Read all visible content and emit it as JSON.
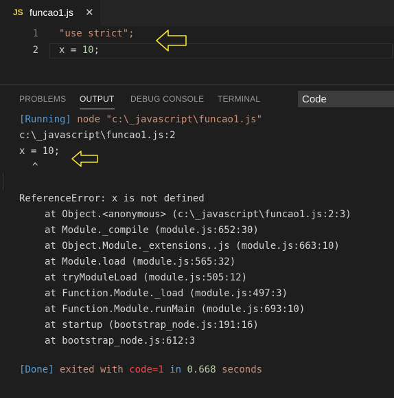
{
  "tab": {
    "lang_badge": "JS",
    "filename": "funcao1.js",
    "close": "✕"
  },
  "editor": {
    "lines": [
      {
        "number": "1",
        "text": "\"use strict\";"
      },
      {
        "number": "2",
        "prefix": "x = ",
        "value": "10",
        "suffix": ";"
      }
    ]
  },
  "panel": {
    "tabs": [
      "PROBLEMS",
      "OUTPUT",
      "DEBUG CONSOLE",
      "TERMINAL"
    ],
    "active_tab": "OUTPUT",
    "channel": "Code"
  },
  "output": {
    "running_tag": "[Running]",
    "running_cmd": "node \"c:\\_javascript\\funcao1.js\"",
    "file_line": "c:\\_javascript\\funcao1.js:2",
    "code_line": "x = 10;",
    "caret": "^",
    "error": "ReferenceError: x is not defined",
    "stack": [
      "at Object.<anonymous> (c:\\_javascript\\funcao1.js:2:3)",
      "at Module._compile (module.js:652:30)",
      "at Object.Module._extensions..js (module.js:663:10)",
      "at Module.load (module.js:565:32)",
      "at tryModuleLoad (module.js:505:12)",
      "at Function.Module._load (module.js:497:3)",
      "at Function.Module.runMain (module.js:693:10)",
      "at startup (bootstrap_node.js:191:16)",
      "at bootstrap_node.js:612:3"
    ],
    "done": {
      "tag": "[Done]",
      "text1": "exited with",
      "code": "code=1",
      "text2": "in",
      "time": "0.668",
      "text3": "seconds"
    }
  },
  "colors": {
    "background": "#1e1e1e",
    "arrow": "#f5e62a",
    "keyword_blue": "#569cd6",
    "string_orange": "#ce9178",
    "error_red": "#f44747"
  }
}
